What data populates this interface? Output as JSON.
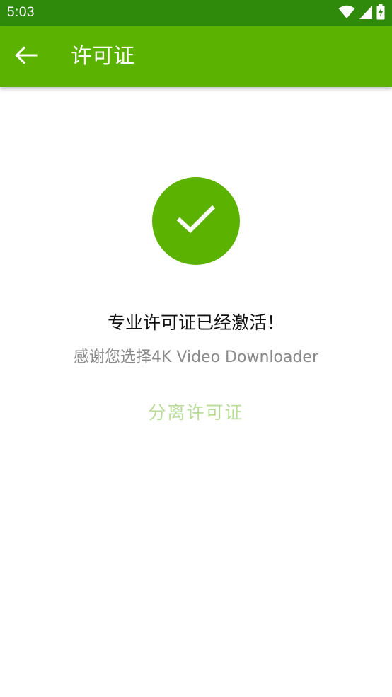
{
  "status_bar": {
    "time": "5:03",
    "icons": [
      "wifi-icon",
      "signal-icon",
      "battery-charging-icon"
    ]
  },
  "app_bar": {
    "back_icon": "arrow-left-icon",
    "title": "许可证"
  },
  "content": {
    "check_icon": "checkmark-icon",
    "headline": "专业许可证已经激活！",
    "subtitle": "感谢您选择4K Video Downloader",
    "detach_label": "分离许可证"
  },
  "colors": {
    "status_bar": "#2f8a0b",
    "app_bar": "#5cb200",
    "accent": "#5cb200",
    "detach_text": "#b8dc97",
    "subtitle_text": "#8a8a8a"
  }
}
